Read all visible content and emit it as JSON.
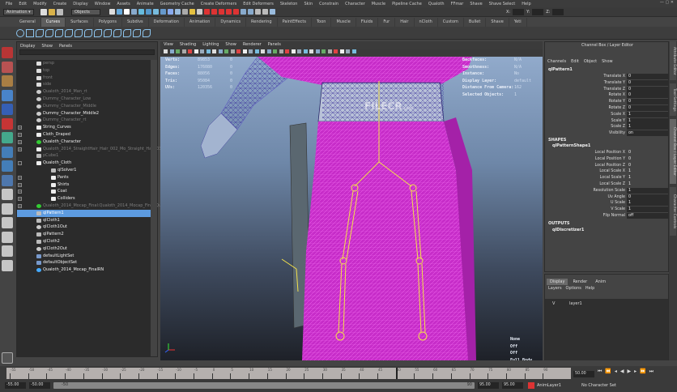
{
  "menubar": [
    "File",
    "Edit",
    "Modify",
    "Create",
    "Display",
    "Window",
    "Assets",
    "Animate",
    "Geometry Cache",
    "Create Deformers",
    "Edit Deformers",
    "Skeleton",
    "Skin",
    "Constrain",
    "Character",
    "Muscle",
    "Pipeline Cache",
    "Qualoth",
    "FFmar",
    "Shave",
    "Shave Select",
    "Help"
  ],
  "status": {
    "mode": "Animation",
    "selection_mode": "Objects",
    "x_label": "X:",
    "y_label": "Y:",
    "z_label": "Z:"
  },
  "shelf_tabs": [
    "General",
    "Curves",
    "Surfaces",
    "Polygons",
    "Subdivs",
    "Deformation",
    "Animation",
    "Dynamics",
    "Rendering",
    "PaintEffects",
    "Toon",
    "Muscle",
    "Fluids",
    "Fur",
    "Hair",
    "nCloth",
    "Custom",
    "Bullet",
    "Shave",
    "Yeti"
  ],
  "shelf_active": "Curves",
  "outliner": {
    "menu": [
      "Display",
      "Show",
      "Panels"
    ],
    "items": [
      {
        "label": "persp",
        "indent": 0,
        "dim": true,
        "icon": "camera"
      },
      {
        "label": "top",
        "indent": 0,
        "dim": true,
        "icon": "camera"
      },
      {
        "label": "front",
        "indent": 0,
        "dim": true,
        "icon": "camera"
      },
      {
        "label": "side",
        "indent": 0,
        "dim": true,
        "icon": "camera"
      },
      {
        "label": "Qualoth_2014_Man_rt",
        "indent": 0,
        "dim": true,
        "icon": "eye"
      },
      {
        "label": "Dummy_Character_Low",
        "indent": 0,
        "dim": true,
        "icon": "eye"
      },
      {
        "label": "Dummy_Character_Middle",
        "indent": 0,
        "dim": true,
        "icon": "eye"
      },
      {
        "label": "Dummy_Character_Middle2",
        "indent": 0,
        "dim": false,
        "icon": "eye"
      },
      {
        "label": "Dummy_Character_rt",
        "indent": 0,
        "dim": true,
        "icon": "eye"
      },
      {
        "label": "String_Curves",
        "indent": 0,
        "dim": false,
        "icon": "group",
        "expand": "+"
      },
      {
        "label": "Cloth_Draped",
        "indent": 0,
        "dim": false,
        "icon": "group",
        "expand": "+"
      },
      {
        "label": "Qualoth_Character",
        "indent": 0,
        "dim": false,
        "icon": "joint",
        "expand": "+"
      },
      {
        "label": "Qualoth_2014_StraightHair_Hair_002_Mo_Straight_Hair_03",
        "indent": 0,
        "dim": true,
        "icon": "group",
        "expand": "+"
      },
      {
        "label": "pCube1",
        "indent": 0,
        "dim": true,
        "icon": "mesh"
      },
      {
        "label": "Qualoth_Cloth",
        "indent": 0,
        "dim": false,
        "icon": "group",
        "expand": "-"
      },
      {
        "label": "qlSolver1",
        "indent": 1,
        "dim": false,
        "icon": "mesh"
      },
      {
        "label": "Pants",
        "indent": 1,
        "dim": false,
        "icon": "group",
        "expand": "+"
      },
      {
        "label": "Shirts",
        "indent": 1,
        "dim": false,
        "icon": "group",
        "expand": "+"
      },
      {
        "label": "Coat",
        "indent": 1,
        "dim": false,
        "icon": "group",
        "expand": "+"
      },
      {
        "label": "Colliders",
        "indent": 1,
        "dim": false,
        "icon": "group",
        "expand": "+"
      },
      {
        "label": "Qualoth_2014_Mocap_Final:Qualoth_2014_Mocap_Final:Qualoth",
        "indent": 0,
        "dim": true,
        "icon": "joint",
        "expand": "+"
      },
      {
        "label": "qlPattern1",
        "indent": 0,
        "dim": false,
        "icon": "mesh",
        "selected": true
      },
      {
        "label": "qlCloth1",
        "indent": 0,
        "dim": false,
        "icon": "mesh"
      },
      {
        "label": "qlCloth1Out",
        "indent": 0,
        "dim": false,
        "icon": "eye"
      },
      {
        "label": "qlPattern2",
        "indent": 0,
        "dim": false,
        "icon": "mesh"
      },
      {
        "label": "qlCloth2",
        "indent": 0,
        "dim": false,
        "icon": "mesh"
      },
      {
        "label": "qlCloth2Out",
        "indent": 0,
        "dim": false,
        "icon": "eye"
      },
      {
        "label": "defaultLightSet",
        "indent": 0,
        "dim": false,
        "icon": "set"
      },
      {
        "label": "defaultObjectSet",
        "indent": 0,
        "dim": false,
        "icon": "set"
      },
      {
        "label": "Qualoth_2014_Mocap_FinalRN",
        "indent": 0,
        "dim": false,
        "icon": "ref"
      }
    ]
  },
  "viewport": {
    "menu": [
      "View",
      "Shading",
      "Lighting",
      "Show",
      "Renderer",
      "Panels"
    ],
    "hud_left": [
      {
        "label": "Verts:",
        "value": "89853",
        "sel": "0"
      },
      {
        "label": "Edges:",
        "value": "176080",
        "sel": "0"
      },
      {
        "label": "Faces:",
        "value": "88056",
        "sel": "0"
      },
      {
        "label": "Tris:",
        "value": "95084",
        "sel": "0"
      },
      {
        "label": "UVs:",
        "value": "120356",
        "sel": "0"
      }
    ],
    "hud_right": [
      {
        "label": "Backfaces:",
        "value": "N/A"
      },
      {
        "label": "Smoothness:",
        "value": "N/A"
      },
      {
        "label": "Instance:",
        "value": "No"
      },
      {
        "label": "Display Layer:",
        "value": "default"
      },
      {
        "label": "Distance From Camera:",
        "value": "162"
      },
      {
        "label": "Selected Objects:",
        "value": "1"
      }
    ],
    "hud_bottom": [
      "None",
      "Off",
      "Off",
      "Full Body"
    ],
    "watermark": "FILECR",
    "watermark_sub": ".com"
  },
  "channel_box": {
    "title": "Channel Box / Layer Editor",
    "menu": [
      "Channels",
      "Edit",
      "Object",
      "Show"
    ],
    "object": "qlPattern1",
    "channels": [
      {
        "name": "Translate X",
        "value": "0"
      },
      {
        "name": "Translate Y",
        "value": "0"
      },
      {
        "name": "Translate Z",
        "value": "0"
      },
      {
        "name": "Rotate X",
        "value": "0"
      },
      {
        "name": "Rotate Y",
        "value": "0"
      },
      {
        "name": "Rotate Z",
        "value": "0"
      },
      {
        "name": "Scale X",
        "value": "1"
      },
      {
        "name": "Scale Y",
        "value": "1"
      },
      {
        "name": "Scale Z",
        "value": "1"
      },
      {
        "name": "Visibility",
        "value": "on"
      }
    ],
    "shapes_label": "SHAPES",
    "shape": "qlPatternShape1",
    "shape_channels": [
      {
        "name": "Local Position X",
        "value": "0",
        "field": false
      },
      {
        "name": "Local Position Y",
        "value": "0",
        "field": false
      },
      {
        "name": "Local Position Z",
        "value": "0",
        "field": false
      },
      {
        "name": "Local Scale X",
        "value": "1",
        "field": false
      },
      {
        "name": "Local Scale Y",
        "value": "1",
        "field": false
      },
      {
        "name": "Local Scale Z",
        "value": "1",
        "field": false
      },
      {
        "name": "Resolution Scale",
        "value": "1",
        "field": true
      },
      {
        "name": "Uv Angle",
        "value": "0",
        "field": true
      },
      {
        "name": "U Scale",
        "value": "1",
        "field": true
      },
      {
        "name": "V Scale",
        "value": "1",
        "field": true
      },
      {
        "name": "Flip Normal",
        "value": "off",
        "field": true
      }
    ],
    "outputs_label": "OUTPUTS",
    "output": "qlDiscretizer1"
  },
  "side_tabs": [
    "Attribute Editor",
    "Tool Settings",
    "Channel Box / Layer Editor",
    "Character Controls"
  ],
  "layer_editor": {
    "tabs": [
      "Display",
      "Render",
      "Anim"
    ],
    "menu": [
      "Layers",
      "Options",
      "Help"
    ],
    "layer": "layer1",
    "visible": "V"
  },
  "timeline": {
    "ticks": [
      -55,
      -50,
      -45,
      -40,
      -35,
      -30,
      -25,
      -20,
      -15,
      -10,
      -5,
      0,
      5,
      10,
      15,
      20,
      25,
      30,
      35,
      40,
      45,
      50,
      55,
      60,
      65,
      70,
      75,
      80,
      85,
      90
    ],
    "current_frame": "50.00",
    "start": "-55.00",
    "range_start": "-50.00",
    "range_start_slider": "-50",
    "range_end_slider": "90",
    "range_end": "95.00",
    "end": "95.00",
    "anim_layer": "AnimLayer1",
    "character_set": "No Character Set"
  }
}
